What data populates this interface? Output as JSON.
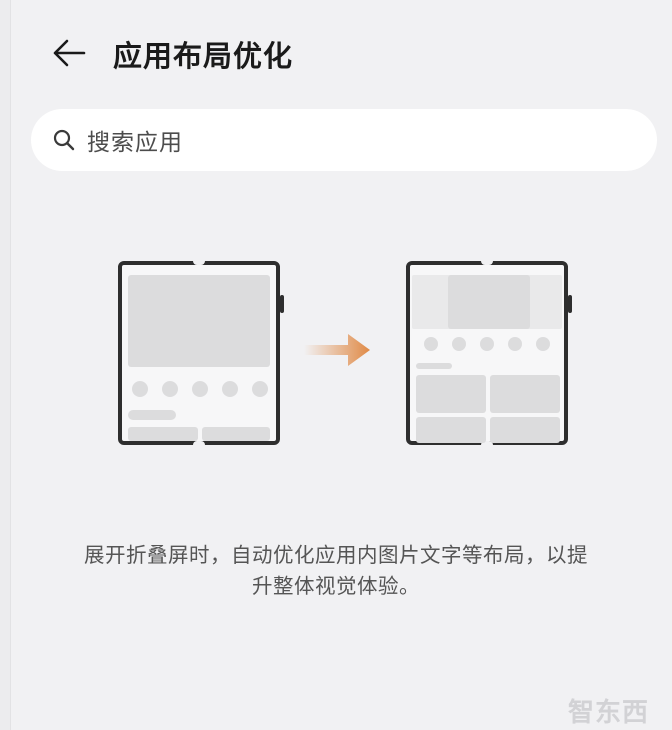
{
  "header": {
    "title": "应用布局优化",
    "back_icon": "arrow-left-icon"
  },
  "search": {
    "placeholder": "搜索应用",
    "icon": "search-icon"
  },
  "illustration": {
    "accent_color": "#e08a46"
  },
  "description": {
    "line1": "展开折叠屏时，自动优化应用内图片文字等布局，以提",
    "line2": "升整体视觉体验。"
  },
  "watermark": {
    "text": "智东西"
  }
}
